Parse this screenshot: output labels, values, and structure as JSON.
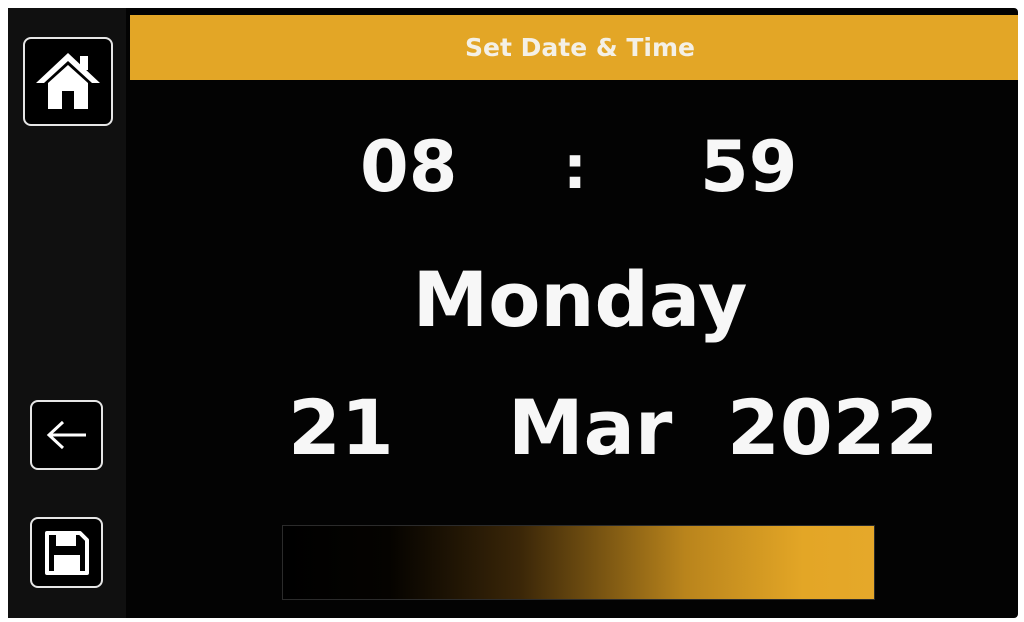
{
  "header": {
    "title": "Set Date & Time"
  },
  "time": {
    "hour": "08",
    "separator": ":",
    "minute": "59"
  },
  "date": {
    "weekday": "Monday",
    "day": "21",
    "month": "Mar",
    "year": "2022"
  },
  "sidebar": {
    "icons": [
      "home-icon",
      "back-arrow-icon",
      "floppy-disk-save-icon"
    ]
  },
  "colors": {
    "accent": "#e3a626",
    "background": "#000000",
    "text": "#f7f7f7"
  }
}
